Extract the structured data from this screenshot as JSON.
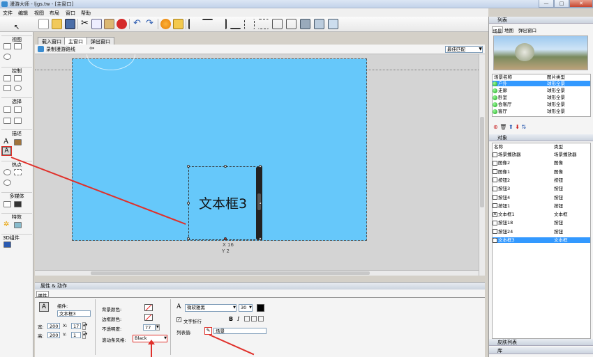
{
  "window": {
    "title": "漫游大师 - ljgs.tw - [主窗口]",
    "min": "—",
    "max": "□",
    "close": "✕"
  },
  "menu": [
    "文件",
    "编辑",
    "视图",
    "布局",
    "窗口",
    "帮助"
  ],
  "left_sections": [
    "视图",
    "控制",
    "选择",
    "描述",
    "热点",
    "多媒体",
    "特效",
    "3D组件"
  ],
  "doc_tabs": [
    "载入窗口",
    "主窗口",
    "弹出窗口"
  ],
  "doc_toolbar": {
    "record_label": "录制漫游路线",
    "zoom_value": "最佳匹配"
  },
  "canvas": {
    "textbox_text": "文本框3",
    "coord_x": "X 16",
    "coord_y": "Y 2"
  },
  "props": {
    "panel_title": "属性 & 动作",
    "tab": "属性",
    "component_label": "组件:",
    "component_value": "文本框3",
    "width_label": "宽:",
    "width_value": "200",
    "height_label": "高:",
    "height_value": "200",
    "x_label": "X:",
    "x_value": "17",
    "y_label": "Y:",
    "y_value": "1",
    "bg_color_label": "背景颜色:",
    "border_color_label": "边框颜色:",
    "opacity_label": "不透明度:",
    "opacity_value": "77",
    "scrollbar_label": "滚动条风格:",
    "scrollbar_value": "Black",
    "font_value": "微软雅黑",
    "font_size": "30",
    "wrap_label": "文字折行",
    "bold": "B",
    "italic": "I",
    "list_value_label": "列表值:",
    "list_value": "场景"
  },
  "right": {
    "list_header": "列表",
    "list_tabs": [
      "场景",
      "地图",
      "弹出窗口"
    ],
    "scene_cols": [
      "场景名称",
      "图片类型"
    ],
    "scenes": [
      {
        "name": "户外",
        "type": "球形全景",
        "selected": true
      },
      {
        "name": "走廊",
        "type": "球形全景",
        "selected": false
      },
      {
        "name": "卧室",
        "type": "球形全景",
        "selected": false
      },
      {
        "name": "会客厅",
        "type": "球形全景",
        "selected": false
      },
      {
        "name": "客厅",
        "type": "球形全景",
        "selected": false
      }
    ],
    "objects_header": "对象",
    "object_cols": [
      "名称",
      "类型"
    ],
    "objects": [
      {
        "name": "场景播放器",
        "type": "场景播放器",
        "selected": false
      },
      {
        "name": "图像2",
        "type": "图像",
        "selected": false
      },
      {
        "name": "图像1",
        "type": "图像",
        "selected": false
      },
      {
        "name": "按钮2",
        "type": "按钮",
        "selected": false
      },
      {
        "name": "按钮3",
        "type": "按钮",
        "selected": false
      },
      {
        "name": "按钮4",
        "type": "按钮",
        "selected": false
      },
      {
        "name": "按钮1",
        "type": "按钮",
        "selected": false
      },
      {
        "name": "文本框1",
        "type": "文本框",
        "selected": false
      },
      {
        "name": "按钮18",
        "type": "按钮",
        "selected": false
      },
      {
        "name": "按钮24",
        "type": "按钮",
        "selected": false
      },
      {
        "name": "文本框3",
        "type": "文本框",
        "selected": true
      }
    ],
    "skin_header": "皮肤列表",
    "lib_header": "库"
  },
  "colors": {
    "canvas_scene": "#66c8fa",
    "selection": "#3399ff",
    "annotation_arrow": "#e0302a"
  }
}
